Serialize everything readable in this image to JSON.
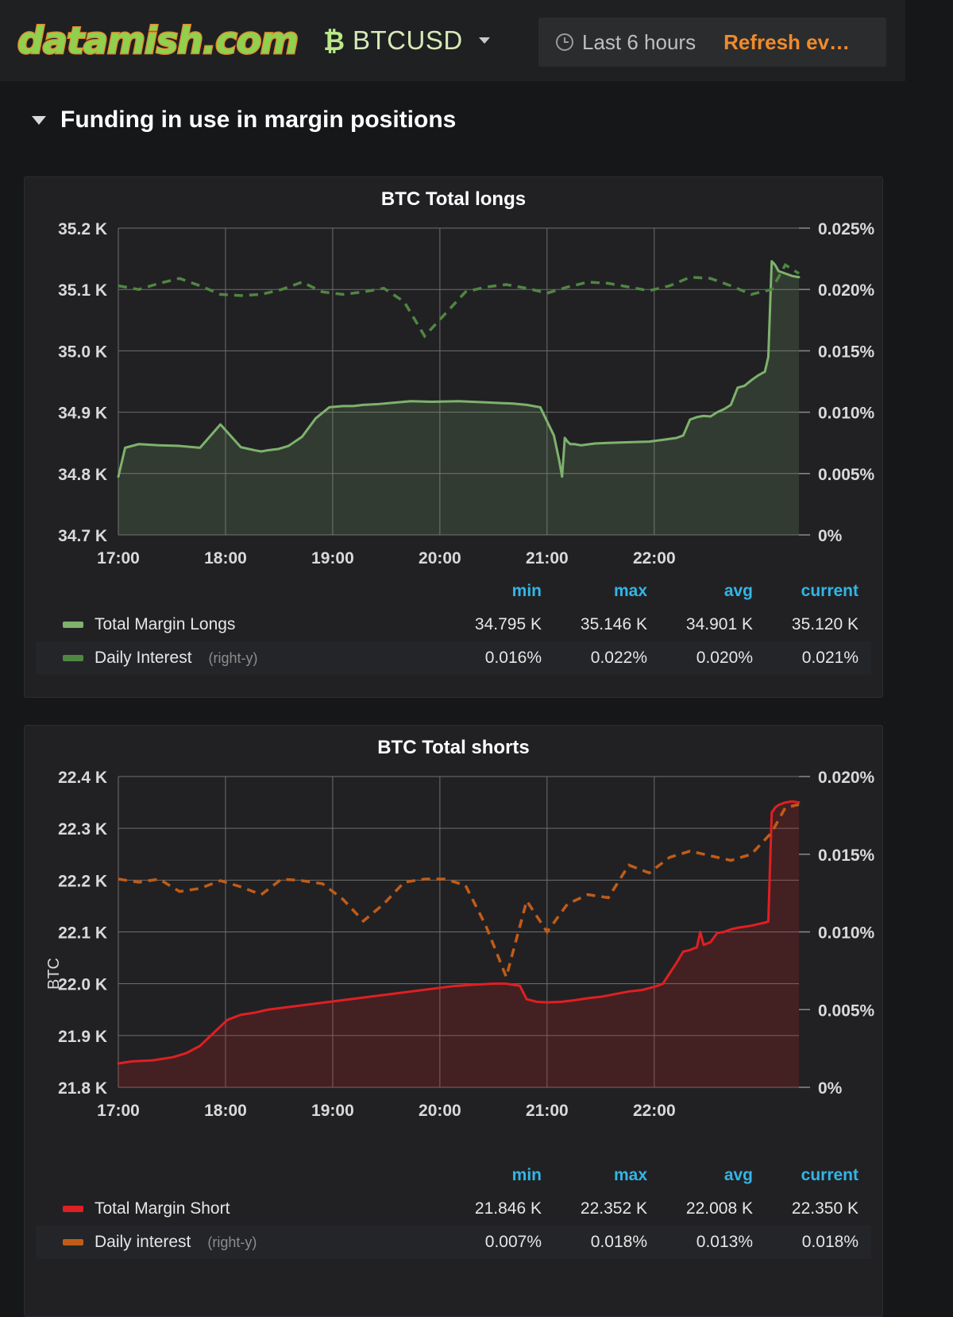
{
  "topnav": {
    "logo_text": "datamish.com",
    "btc_icon": "bitcoin-icon",
    "symbol": "BTCUSD",
    "time_range": "Last 6 hours",
    "refresh": "Refresh ev…"
  },
  "row": {
    "title": "Funding in use in margin positions"
  },
  "panels": [
    {
      "title": "BTC Total longs",
      "y_axis_label": "",
      "legend_headers": [
        "min",
        "max",
        "avg",
        "current"
      ],
      "series": [
        {
          "name": "Total Margin Longs",
          "suffix": "",
          "color": "#7eb26d",
          "min": "34.795 K",
          "max": "35.146 K",
          "avg": "34.901 K",
          "current": "35.120 K"
        },
        {
          "name": "Daily Interest",
          "suffix": "(right-y)",
          "color": "#508642",
          "min": "0.016%",
          "max": "0.022%",
          "avg": "0.020%",
          "current": "0.021%"
        }
      ]
    },
    {
      "title": "BTC Total shorts",
      "y_axis_label": "BTC",
      "legend_headers": [
        "min",
        "max",
        "avg",
        "current"
      ],
      "series": [
        {
          "name": "Total Margin Short",
          "suffix": "",
          "color": "#e01f22",
          "min": "21.846 K",
          "max": "22.352 K",
          "avg": "22.008 K",
          "current": "22.350 K"
        },
        {
          "name": "Daily interest",
          "suffix": "(right-y)",
          "color": "#c15c17",
          "min": "0.007%",
          "max": "0.018%",
          "avg": "0.013%",
          "current": "0.018%"
        }
      ]
    }
  ],
  "chart_data": [
    {
      "type": "area",
      "title": "BTC Total longs",
      "xlabel": "",
      "ylabel": "",
      "y2label": "",
      "x_ticks": [
        "17:00",
        "18:00",
        "19:00",
        "20:00",
        "21:00",
        "22:00"
      ],
      "y_ticks": [
        "34.7 K",
        "34.8 K",
        "34.9 K",
        "35.0 K",
        "35.1 K",
        "35.2 K"
      ],
      "ylim": [
        34700,
        35200
      ],
      "y2_ticks": [
        "0%",
        "0.005%",
        "0.010%",
        "0.015%",
        "0.020%",
        "0.025%"
      ],
      "y2lim": [
        0,
        0.025
      ],
      "grid": true,
      "legend_position": "below",
      "series": [
        {
          "name": "Total Margin Longs",
          "axis": "left",
          "style": "solid-area",
          "color": "#7eb26d",
          "x": [
            0,
            0.01,
            0.03,
            0.06,
            0.09,
            0.12,
            0.15,
            0.18,
            0.2,
            0.21,
            0.22,
            0.235,
            0.25,
            0.27,
            0.29,
            0.31,
            0.33,
            0.345,
            0.36,
            0.38,
            0.4,
            0.43,
            0.46,
            0.5,
            0.54,
            0.58,
            0.6,
            0.62,
            0.64,
            0.648,
            0.652,
            0.656,
            0.66,
            0.664,
            0.67,
            0.68,
            0.7,
            0.72,
            0.75,
            0.78,
            0.8,
            0.82,
            0.83,
            0.84,
            0.85,
            0.86,
            0.87,
            0.88,
            0.89,
            0.9,
            0.91,
            0.92,
            0.93,
            0.94,
            0.95,
            0.955,
            0.96,
            0.965,
            0.97,
            0.98,
            0.99,
            1.0
          ],
          "y": [
            34795,
            34842,
            34848,
            34846,
            34845,
            34842,
            34880,
            34843,
            34838,
            34836,
            34838,
            34840,
            34845,
            34860,
            34890,
            34908,
            34910,
            34910,
            34912,
            34913,
            34915,
            34918,
            34917,
            34918,
            34916,
            34914,
            34912,
            34908,
            34862,
            34820,
            34795,
            34858,
            34852,
            34848,
            34848,
            34846,
            34849,
            34850,
            34851,
            34852,
            34855,
            34858,
            34862,
            34888,
            34892,
            34894,
            34893,
            34900,
            34905,
            34912,
            34940,
            34943,
            34952,
            34960,
            34966,
            34990,
            35146,
            35140,
            35130,
            35126,
            35122,
            35120
          ]
        },
        {
          "name": "Daily Interest",
          "axis": "right",
          "style": "dashed",
          "color": "#508642",
          "x": [
            0,
            0.03,
            0.06,
            0.09,
            0.12,
            0.15,
            0.18,
            0.21,
            0.24,
            0.27,
            0.3,
            0.33,
            0.36,
            0.39,
            0.42,
            0.45,
            0.48,
            0.51,
            0.54,
            0.57,
            0.6,
            0.63,
            0.66,
            0.69,
            0.72,
            0.75,
            0.78,
            0.81,
            0.84,
            0.87,
            0.9,
            0.93,
            0.96,
            0.98,
            1.0
          ],
          "y": [
            0.0203,
            0.02,
            0.0205,
            0.0209,
            0.0203,
            0.0196,
            0.0195,
            0.0196,
            0.02,
            0.0206,
            0.0198,
            0.0196,
            0.0198,
            0.0201,
            0.019,
            0.0162,
            0.018,
            0.0198,
            0.0202,
            0.0204,
            0.0201,
            0.0197,
            0.0202,
            0.0206,
            0.0205,
            0.0202,
            0.0199,
            0.0203,
            0.021,
            0.0209,
            0.0203,
            0.0196,
            0.02,
            0.022,
            0.0213
          ]
        }
      ]
    },
    {
      "type": "area",
      "title": "BTC Total shorts",
      "xlabel": "",
      "ylabel": "BTC",
      "y2label": "",
      "x_ticks": [
        "17:00",
        "18:00",
        "19:00",
        "20:00",
        "21:00",
        "22:00"
      ],
      "y_ticks": [
        "21.8 K",
        "21.9 K",
        "22.0 K",
        "22.1 K",
        "22.2 K",
        "22.3 K",
        "22.4 K"
      ],
      "ylim": [
        21800,
        22400
      ],
      "y2_ticks": [
        "0%",
        "0.005%",
        "0.010%",
        "0.015%",
        "0.020%"
      ],
      "y2lim": [
        0,
        0.02
      ],
      "grid": true,
      "legend_position": "below",
      "series": [
        {
          "name": "Total Margin Short",
          "axis": "left",
          "style": "solid-area",
          "color": "#e01f22",
          "x": [
            0,
            0.02,
            0.05,
            0.08,
            0.1,
            0.12,
            0.14,
            0.16,
            0.18,
            0.2,
            0.22,
            0.25,
            0.28,
            0.31,
            0.34,
            0.37,
            0.4,
            0.43,
            0.46,
            0.49,
            0.52,
            0.55,
            0.57,
            0.59,
            0.6,
            0.615,
            0.63,
            0.65,
            0.67,
            0.69,
            0.71,
            0.73,
            0.75,
            0.77,
            0.79,
            0.8,
            0.81,
            0.82,
            0.83,
            0.84,
            0.845,
            0.85,
            0.855,
            0.86,
            0.87,
            0.88,
            0.89,
            0.9,
            0.91,
            0.92,
            0.93,
            0.94,
            0.95,
            0.955,
            0.96,
            0.965,
            0.97,
            0.98,
            0.99,
            1.0
          ],
          "y": [
            21846,
            21850,
            21852,
            21858,
            21866,
            21880,
            21905,
            21930,
            21940,
            21944,
            21950,
            21955,
            21960,
            21965,
            21970,
            21975,
            21980,
            21985,
            21990,
            21995,
            21998,
            22000,
            22000,
            21996,
            21970,
            21965,
            21964,
            21965,
            21968,
            21972,
            21975,
            21980,
            21985,
            21988,
            21995,
            22000,
            22020,
            22040,
            22062,
            22065,
            22068,
            22070,
            22100,
            22075,
            22080,
            22098,
            22100,
            22105,
            22108,
            22110,
            22112,
            22115,
            22118,
            22120,
            22330,
            22340,
            22345,
            22350,
            22352,
            22350
          ]
        },
        {
          "name": "Daily interest",
          "axis": "right",
          "style": "dashed",
          "color": "#c15c17",
          "x": [
            0,
            0.03,
            0.06,
            0.09,
            0.12,
            0.15,
            0.18,
            0.21,
            0.24,
            0.27,
            0.3,
            0.33,
            0.36,
            0.39,
            0.42,
            0.45,
            0.48,
            0.51,
            0.54,
            0.57,
            0.6,
            0.63,
            0.66,
            0.69,
            0.72,
            0.75,
            0.78,
            0.81,
            0.84,
            0.87,
            0.9,
            0.93,
            0.96,
            0.98,
            1.0
          ],
          "y": [
            0.0134,
            0.0132,
            0.0134,
            0.0126,
            0.0128,
            0.0133,
            0.0129,
            0.0124,
            0.0134,
            0.0133,
            0.0131,
            0.0121,
            0.0107,
            0.0118,
            0.0132,
            0.0134,
            0.0134,
            0.013,
            0.0104,
            0.0071,
            0.012,
            0.01,
            0.0118,
            0.0124,
            0.0122,
            0.0143,
            0.0138,
            0.0148,
            0.0152,
            0.0149,
            0.0146,
            0.015,
            0.0164,
            0.018,
            0.0182
          ]
        }
      ]
    }
  ]
}
